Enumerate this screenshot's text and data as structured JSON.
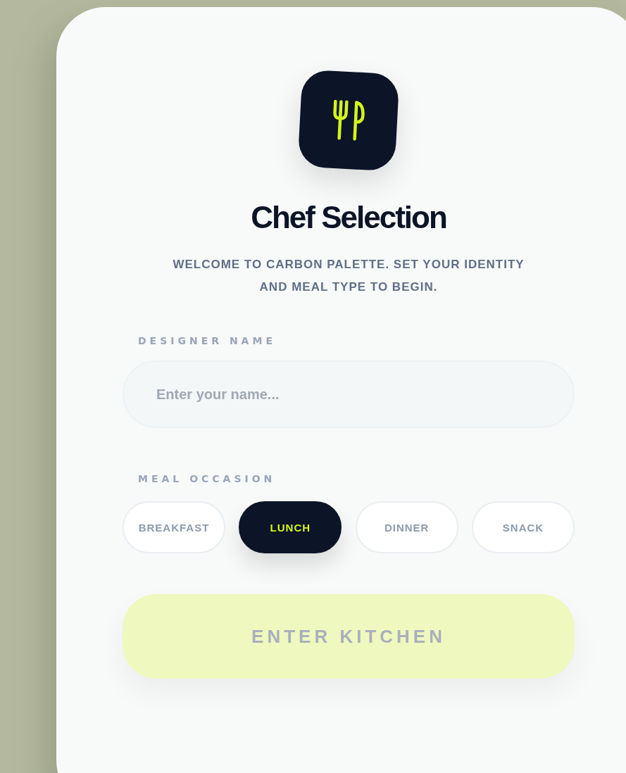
{
  "title": "Chef Selection",
  "subtitle": "WELCOME TO CARBON PALETTE. SET YOUR IDENTITY AND MEAL TYPE TO BEGIN.",
  "name_field": {
    "label": "DESIGNER NAME",
    "placeholder": "Enter your name..."
  },
  "meal_occasion": {
    "label": "MEAL OCCASION",
    "options": [
      {
        "label": "BREAKFAST",
        "selected": false
      },
      {
        "label": "LUNCH",
        "selected": true
      },
      {
        "label": "DINNER",
        "selected": false
      },
      {
        "label": "SNACK",
        "selected": false
      }
    ]
  },
  "submit": {
    "label": "ENTER KITCHEN",
    "disabled": true
  }
}
